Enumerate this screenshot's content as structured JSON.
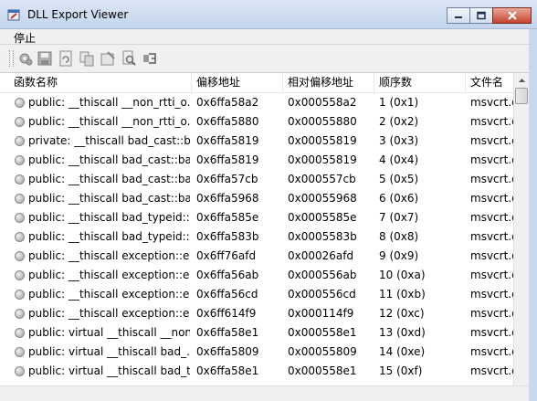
{
  "window": {
    "title": "DLL Export Viewer",
    "controls": [
      "minimize-icon",
      "maximize-icon",
      "close-icon"
    ]
  },
  "menu": {
    "items": [
      {
        "label": "停止"
      }
    ]
  },
  "toolbar": {
    "buttons": [
      "gear-icon",
      "save-icon",
      "refresh-icon",
      "copy-icon",
      "properties-icon",
      "search-icon",
      "export-icon"
    ]
  },
  "columns": [
    "函数名称",
    "偏移地址",
    "相对偏移地址",
    "顺序数",
    "文件名"
  ],
  "rows": [
    [
      "public: __thiscall __non_rtti_o...",
      "0x6ffa58a2",
      "0x000558a2",
      "1 (0x1)",
      "msvcrt.d"
    ],
    [
      "public: __thiscall __non_rtti_o...",
      "0x6ffa5880",
      "0x00055880",
      "2 (0x2)",
      "msvcrt.d"
    ],
    [
      "private: __thiscall bad_cast::b...",
      "0x6ffa5819",
      "0x00055819",
      "3 (0x3)",
      "msvcrt.d"
    ],
    [
      "public: __thiscall bad_cast::ba...",
      "0x6ffa5819",
      "0x00055819",
      "4 (0x4)",
      "msvcrt.d"
    ],
    [
      "public: __thiscall bad_cast::ba...",
      "0x6ffa57cb",
      "0x000557cb",
      "5 (0x5)",
      "msvcrt.d"
    ],
    [
      "public: __thiscall bad_cast::ba...",
      "0x6ffa5968",
      "0x00055968",
      "6 (0x6)",
      "msvcrt.d"
    ],
    [
      "public: __thiscall bad_typeid::...",
      "0x6ffa585e",
      "0x0005585e",
      "7 (0x7)",
      "msvcrt.d"
    ],
    [
      "public: __thiscall bad_typeid::...",
      "0x6ffa583b",
      "0x0005583b",
      "8 (0x8)",
      "msvcrt.d"
    ],
    [
      "public: __thiscall exception::e...",
      "0x6ff76afd",
      "0x00026afd",
      "9 (0x9)",
      "msvcrt.d"
    ],
    [
      "public: __thiscall exception::e...",
      "0x6ffa56ab",
      "0x000556ab",
      "10 (0xa)",
      "msvcrt.d"
    ],
    [
      "public: __thiscall exception::e...",
      "0x6ffa56cd",
      "0x000556cd",
      "11 (0xb)",
      "msvcrt.d"
    ],
    [
      "public: __thiscall exception::e...",
      "0x6ff614f9",
      "0x000114f9",
      "12 (0xc)",
      "msvcrt.d"
    ],
    [
      "public: virtual __thiscall __non...",
      "0x6ffa58e1",
      "0x000558e1",
      "13 (0xd)",
      "msvcrt.d"
    ],
    [
      "public: virtual __thiscall bad_...",
      "0x6ffa5809",
      "0x00055809",
      "14 (0xe)",
      "msvcrt.d"
    ],
    [
      "public: virtual __thiscall bad_t...",
      "0x6ffa58e1",
      "0x000558e1",
      "15 (0xf)",
      "msvcrt.d"
    ]
  ]
}
